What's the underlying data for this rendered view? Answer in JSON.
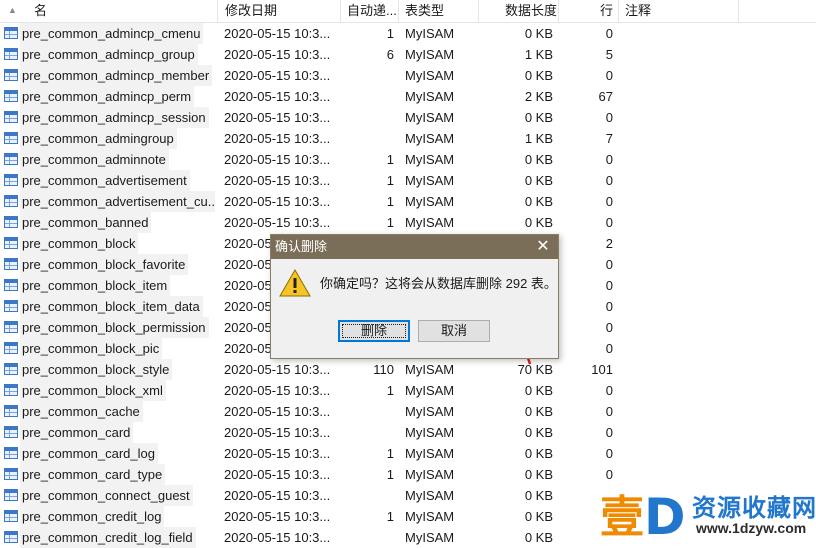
{
  "columns": {
    "name": "名",
    "modified": "修改日期",
    "auto_increment": "自动递...",
    "table_type": "表类型",
    "data_length": "数据长度",
    "rows": "行",
    "comment": "注释"
  },
  "tables": [
    {
      "name": "pre_common_admincp_cmenu",
      "modified": "2020-05-15 10:3...",
      "auto": "1",
      "type": "MyISAM",
      "size": "0 KB",
      "rows": "0"
    },
    {
      "name": "pre_common_admincp_group",
      "modified": "2020-05-15 10:3...",
      "auto": "6",
      "type": "MyISAM",
      "size": "1 KB",
      "rows": "5"
    },
    {
      "name": "pre_common_admincp_member",
      "modified": "2020-05-15 10:3...",
      "auto": "",
      "type": "MyISAM",
      "size": "0 KB",
      "rows": "0"
    },
    {
      "name": "pre_common_admincp_perm",
      "modified": "2020-05-15 10:3...",
      "auto": "",
      "type": "MyISAM",
      "size": "2 KB",
      "rows": "67"
    },
    {
      "name": "pre_common_admincp_session",
      "modified": "2020-05-15 10:3...",
      "auto": "",
      "type": "MyISAM",
      "size": "0 KB",
      "rows": "0"
    },
    {
      "name": "pre_common_admingroup",
      "modified": "2020-05-15 10:3...",
      "auto": "",
      "type": "MyISAM",
      "size": "1 KB",
      "rows": "7"
    },
    {
      "name": "pre_common_adminnote",
      "modified": "2020-05-15 10:3...",
      "auto": "1",
      "type": "MyISAM",
      "size": "0 KB",
      "rows": "0"
    },
    {
      "name": "pre_common_advertisement",
      "modified": "2020-05-15 10:3...",
      "auto": "1",
      "type": "MyISAM",
      "size": "0 KB",
      "rows": "0"
    },
    {
      "name": "pre_common_advertisement_cu...",
      "modified": "2020-05-15 10:3...",
      "auto": "1",
      "type": "MyISAM",
      "size": "0 KB",
      "rows": "0"
    },
    {
      "name": "pre_common_banned",
      "modified": "2020-05-15 10:3...",
      "auto": "1",
      "type": "MyISAM",
      "size": "0 KB",
      "rows": "0"
    },
    {
      "name": "pre_common_block",
      "modified": "2020-05",
      "auto": "",
      "type": "",
      "size": "",
      "rows": "2"
    },
    {
      "name": "pre_common_block_favorite",
      "modified": "2020-05",
      "auto": "",
      "type": "",
      "size": "",
      "rows": "0"
    },
    {
      "name": "pre_common_block_item",
      "modified": "2020-05",
      "auto": "",
      "type": "",
      "size": "",
      "rows": "0"
    },
    {
      "name": "pre_common_block_item_data",
      "modified": "2020-05",
      "auto": "",
      "type": "",
      "size": "",
      "rows": "0"
    },
    {
      "name": "pre_common_block_permission",
      "modified": "2020-05",
      "auto": "",
      "type": "",
      "size": "",
      "rows": "0"
    },
    {
      "name": "pre_common_block_pic",
      "modified": "2020-05",
      "auto": "",
      "type": "",
      "size": "",
      "rows": "0"
    },
    {
      "name": "pre_common_block_style",
      "modified": "2020-05-15 10:3...",
      "auto": "110",
      "type": "MyISAM",
      "size": "70 KB",
      "rows": "101"
    },
    {
      "name": "pre_common_block_xml",
      "modified": "2020-05-15 10:3...",
      "auto": "1",
      "type": "MyISAM",
      "size": "0 KB",
      "rows": "0"
    },
    {
      "name": "pre_common_cache",
      "modified": "2020-05-15 10:3...",
      "auto": "",
      "type": "MyISAM",
      "size": "0 KB",
      "rows": "0"
    },
    {
      "name": "pre_common_card",
      "modified": "2020-05-15 10:3...",
      "auto": "",
      "type": "MyISAM",
      "size": "0 KB",
      "rows": "0"
    },
    {
      "name": "pre_common_card_log",
      "modified": "2020-05-15 10:3...",
      "auto": "1",
      "type": "MyISAM",
      "size": "0 KB",
      "rows": "0"
    },
    {
      "name": "pre_common_card_type",
      "modified": "2020-05-15 10:3...",
      "auto": "1",
      "type": "MyISAM",
      "size": "0 KB",
      "rows": "0"
    },
    {
      "name": "pre_common_connect_guest",
      "modified": "2020-05-15 10:3...",
      "auto": "",
      "type": "MyISAM",
      "size": "0 KB",
      "rows": ""
    },
    {
      "name": "pre_common_credit_log",
      "modified": "2020-05-15 10:3...",
      "auto": "1",
      "type": "MyISAM",
      "size": "0 KB",
      "rows": ""
    },
    {
      "name": "pre_common_credit_log_field",
      "modified": "2020-05-15 10:3...",
      "auto": "",
      "type": "MyISAM",
      "size": "0 KB",
      "rows": ""
    }
  ],
  "dialog": {
    "title": "确认删除",
    "message": "你确定吗？这将会从数据库删除 292 表。",
    "delete_label": "删除",
    "cancel_label": "取消",
    "close_glyph": "✕"
  },
  "watermark": {
    "mark": "壹D",
    "text": "资源收藏网",
    "url": "www.1dzyw.com"
  },
  "colors": {
    "dialog_titlebar": "#7b6e58",
    "annotation_arrow": "#e02020",
    "table_icon": "#3d78c7",
    "watermark_orange": "#f08a00",
    "watermark_blue": "#2277cc"
  },
  "icons": {
    "table": "table-icon",
    "warning": "warning-icon",
    "close": "close-icon",
    "sort": "sort-icon"
  }
}
